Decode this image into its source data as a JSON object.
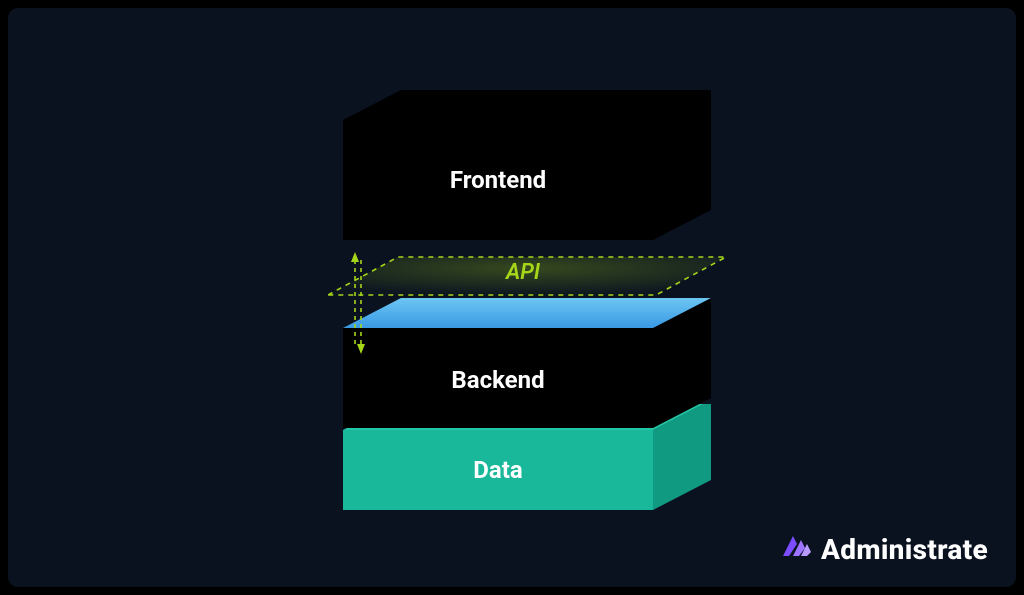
{
  "brand": {
    "name": "Administrate",
    "accent": "#7c4dff"
  },
  "layers": {
    "frontend": {
      "label": "Frontend",
      "colors": {
        "top": "#8a52ff",
        "front": "#6a37e6",
        "right": "#4d22b8"
      }
    },
    "api": {
      "label": "API",
      "color": "#a5d61a"
    },
    "backend": {
      "label": "Backend",
      "colors": {
        "top_grad_from": "#58b8f0",
        "top_grad_to": "#2f8fe0",
        "front": "#1f7fd8",
        "right": "#1563aa"
      }
    },
    "data": {
      "label": "Data",
      "colors": {
        "top": "#21c6a5",
        "front": "#19b89a",
        "right": "#119a82"
      }
    }
  },
  "diagram": {
    "order_top_to_bottom": [
      "frontend",
      "api",
      "backend",
      "data"
    ],
    "api_connects": [
      "frontend",
      "backend"
    ]
  }
}
